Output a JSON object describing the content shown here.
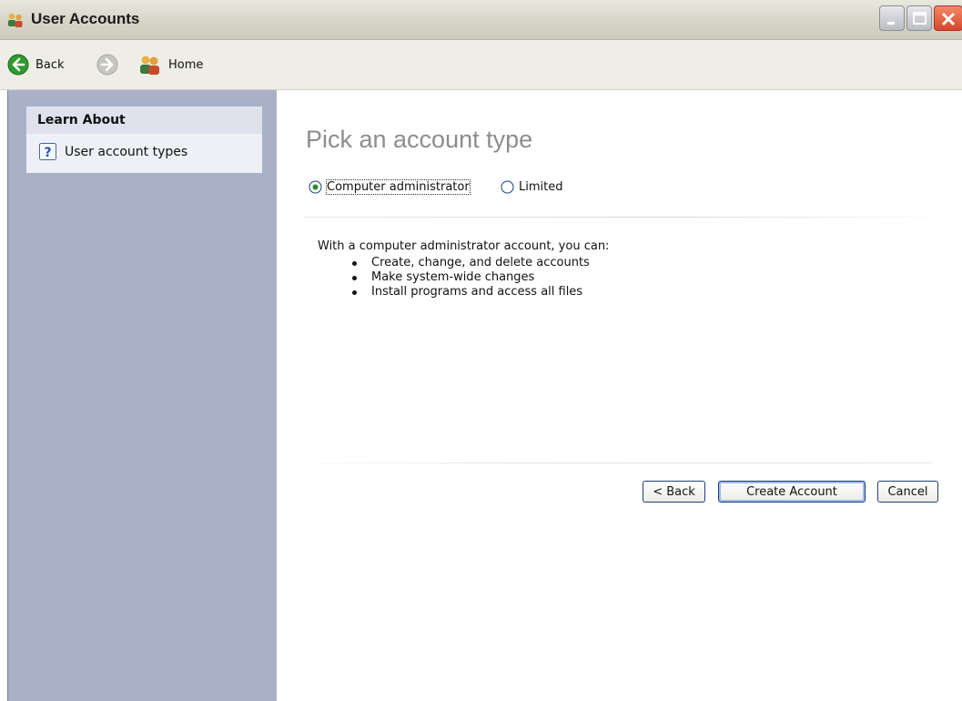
{
  "window": {
    "title": "User Accounts"
  },
  "nav": {
    "back_label": "Back",
    "home_label": "Home"
  },
  "sidebar": {
    "header": "Learn About",
    "items": [
      {
        "label": "User account types",
        "icon": "help-icon"
      }
    ]
  },
  "main": {
    "title": "Pick an account type",
    "account_types": [
      {
        "label": "Computer administrator",
        "selected": true
      },
      {
        "label": "Limited",
        "selected": false
      }
    ],
    "description": "With a computer administrator account, you can:",
    "capabilities": [
      "Create, change, and delete accounts",
      "Make system-wide changes",
      "Install programs and access all files"
    ]
  },
  "buttons": {
    "back": "< Back",
    "create": "Create Account",
    "cancel": "Cancel"
  },
  "colors": {
    "sidebar_bg": "#a9b1c9",
    "title_gray": "#8d8d8d",
    "close_red": "#d8452b"
  }
}
